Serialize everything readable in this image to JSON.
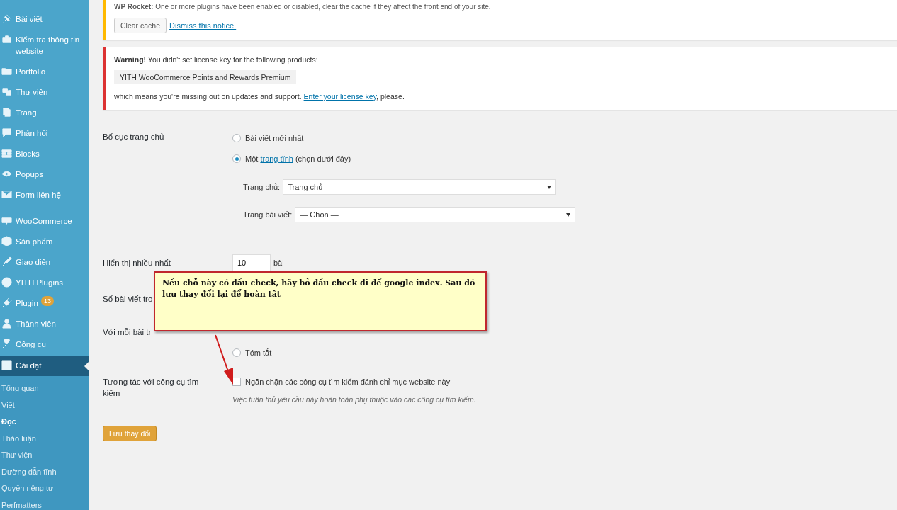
{
  "sidebar": {
    "items": [
      {
        "label": "Bài viết",
        "selected": false
      },
      {
        "label": "Kiểm tra thông tin website",
        "selected": false
      },
      {
        "label": "Portfolio",
        "selected": false
      },
      {
        "label": "Thư viện",
        "selected": false
      },
      {
        "label": "Trang",
        "selected": false
      },
      {
        "label": "Phản hồi",
        "selected": false
      },
      {
        "label": "Blocks",
        "selected": false
      },
      {
        "label": "Popups",
        "selected": false
      },
      {
        "label": "Form liên hệ",
        "selected": false
      },
      {
        "label": "WooCommerce",
        "selected": false
      },
      {
        "label": "Sản phẩm",
        "selected": false
      },
      {
        "label": "Giao diện",
        "selected": false
      },
      {
        "label": "YITH Plugins",
        "selected": false
      },
      {
        "label": "Plugin",
        "selected": false,
        "badge": "13"
      },
      {
        "label": "Thành viên",
        "selected": false
      },
      {
        "label": "Công cụ",
        "selected": false
      },
      {
        "label": "Cài đặt",
        "selected": true
      }
    ],
    "submenu": [
      {
        "label": "Tổng quan",
        "selected": false
      },
      {
        "label": "Viết",
        "selected": false
      },
      {
        "label": "Đọc",
        "selected": true
      },
      {
        "label": "Thảo luận",
        "selected": false
      },
      {
        "label": "Thư viện",
        "selected": false
      },
      {
        "label": "Đường dẫn tĩnh",
        "selected": false
      },
      {
        "label": "Quyền riêng tư",
        "selected": false
      },
      {
        "label": "Perfmatters",
        "selected": false
      }
    ]
  },
  "notices": [
    {
      "kind": "cache",
      "text": "**WP Rocket:** One or more plugins have been enabled or disabled, clear the cache if they affect the front end of your site.",
      "button": "Clear cache",
      "link": "Dismiss this notice."
    },
    {
      "kind": "license",
      "text": "**Warning!** You didn't set license key for the following products:",
      "product": "YITH WooCommerce Points and Rewards Premium",
      "text_before_link": "which means you're missing out on updates and support.",
      "link": "Enter your license key",
      "text_after_link": ", please."
    }
  ],
  "form": {
    "rows": [
      {
        "kind": "radios",
        "label": "Bố cục trang chủ",
        "options": [
          {
            "selected": false,
            "text": "Bài viết mới nhất"
          },
          {
            "selected": true,
            "text": "Một",
            "link": "trang tĩnh",
            "after": "(chọn dưới đây)"
          }
        ],
        "selects": [
          {
            "label": "Trang chủ:",
            "value": "Trang chủ"
          },
          {
            "label": "Trang bài viết:",
            "value": "— Chọn —"
          }
        ]
      },
      {
        "kind": "number",
        "label": "Hiển thị nhiều nhất",
        "value": "10",
        "unit": "bài"
      },
      {
        "kind": "blank",
        "label": "Số bài viết tro"
      },
      {
        "kind": "radios",
        "label": "Với mỗi bài tr",
        "options": [
          {
            "selected": false,
            "text": "Tóm tắt"
          }
        ]
      },
      {
        "kind": "checkbox",
        "label": "Tương tác với công cụ tìm kiếm",
        "checked": false,
        "text": "Ngăn chặn các công cụ tìm kiếm đánh chỉ mục website này",
        "description": "Việc tuân thủ yêu cầu này hoàn toàn phụ thuộc vào các công cụ tìm kiếm."
      }
    ],
    "submit": "Lưu thay đổi"
  },
  "callout": {
    "text": "Nếu chỗ này có dấu check, hãy bỏ dấu check đi để google index. Sau đó lưu thay đổi lại để hoàn tất"
  }
}
